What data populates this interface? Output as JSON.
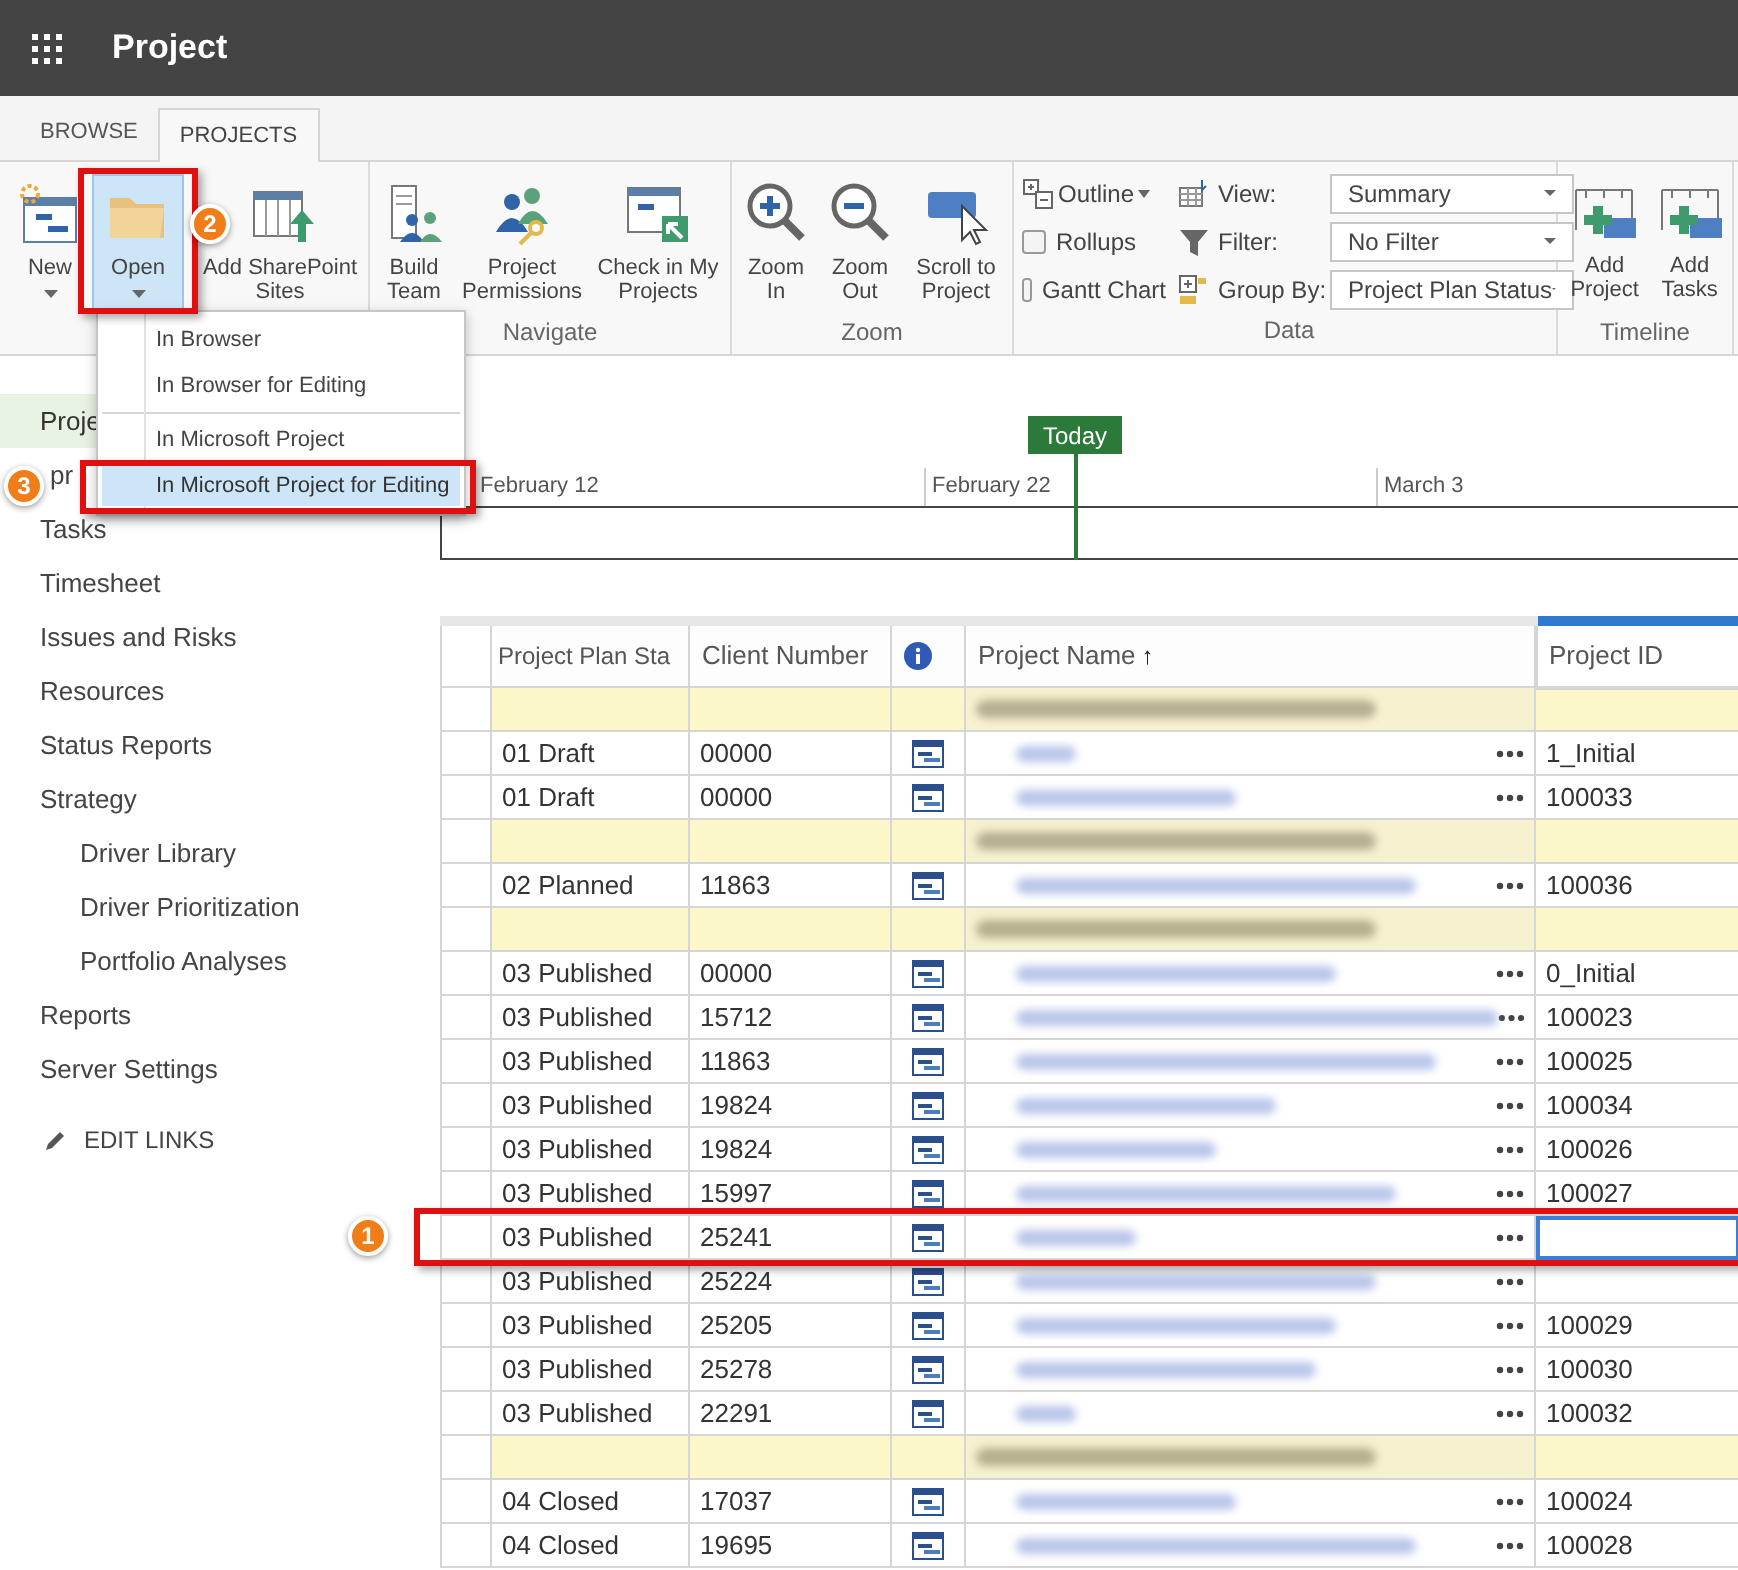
{
  "app": {
    "title": "Project"
  },
  "tabs": [
    {
      "label": "BROWSE",
      "selected": false
    },
    {
      "label": "PROJECTS",
      "selected": true
    }
  ],
  "ribbon": {
    "groups": [
      {
        "buttons": [
          {
            "label": "New",
            "caret": true,
            "selected": false
          },
          {
            "label": "Open",
            "caret": true,
            "selected": true
          },
          {
            "label": "Add SharePoint Sites",
            "caret": false,
            "selected": false
          }
        ]
      },
      {
        "label": "Navigate",
        "buttons": [
          {
            "label": "Build Team",
            "caret": false,
            "selected": false
          },
          {
            "label": "Project Permissions",
            "caret": false,
            "selected": false
          },
          {
            "label": "Check in My Projects",
            "caret": false,
            "selected": false
          }
        ]
      },
      {
        "label": "Zoom",
        "buttons": [
          {
            "label": "Zoom In",
            "caret": false,
            "selected": false
          },
          {
            "label": "Zoom Out",
            "caret": false,
            "selected": false
          },
          {
            "label": "Scroll to Project",
            "caret": false,
            "selected": false
          }
        ]
      }
    ],
    "data_group": {
      "label": "Data",
      "outline": "Outline",
      "checkboxes": [
        {
          "label": "Rollups",
          "checked": false
        },
        {
          "label": "Gantt Chart",
          "checked": false
        }
      ],
      "selects": [
        {
          "label": "View:",
          "value": "Summary"
        },
        {
          "label": "Filter:",
          "value": "No Filter"
        },
        {
          "label": "Group By:",
          "value": "Project Plan Status"
        }
      ]
    },
    "timeline_group": {
      "label": "Timeline",
      "buttons": [
        {
          "label": "Add Project"
        },
        {
          "label": "Add Tasks"
        }
      ]
    }
  },
  "open_menu": {
    "sections": [
      [
        {
          "label": "In Browser",
          "selected": false
        },
        {
          "label": "In Browser for Editing",
          "selected": false
        }
      ],
      [
        {
          "label": "In Microsoft Project",
          "selected": false
        },
        {
          "label": "In Microsoft Project for Editing",
          "selected": true
        }
      ]
    ]
  },
  "sidebar": {
    "items": [
      {
        "label": "Proje",
        "selected": true
      },
      {
        "label": "pr",
        "selected": false
      },
      {
        "label": "Tasks",
        "selected": false
      },
      {
        "label": "Timesheet",
        "selected": false
      },
      {
        "label": "Issues and Risks",
        "selected": false
      },
      {
        "label": "Resources",
        "selected": false
      },
      {
        "label": "Status Reports",
        "selected": false
      },
      {
        "label": "Strategy",
        "selected": false,
        "children": [
          {
            "label": "Driver Library",
            "selected": false
          },
          {
            "label": "Driver Prioritization",
            "selected": false
          },
          {
            "label": "Portfolio Analyses",
            "selected": false
          }
        ]
      },
      {
        "label": "Reports",
        "selected": false
      },
      {
        "label": "Server Settings",
        "selected": false
      }
    ],
    "edit_links": "EDIT LINKS"
  },
  "timeline": {
    "today": "Today",
    "dates": [
      "February 12",
      "February 22",
      "March 3"
    ]
  },
  "grid": {
    "columns": [
      {
        "label": "Project Plan Sta",
        "selected": false
      },
      {
        "label": "Client Number",
        "selected": false
      },
      {
        "kind": "icon"
      },
      {
        "label": "Project Name",
        "sort_indicator": "↑",
        "selected": false
      },
      {
        "label": "Project ID",
        "selected": true
      }
    ],
    "rows": [
      {
        "kind": "group"
      },
      {
        "kind": "project",
        "status": "01 Draft",
        "client": "00000",
        "project_id": "1_Initial",
        "selected": false
      },
      {
        "kind": "project",
        "status": "01 Draft",
        "client": "00000",
        "project_id": "100033",
        "selected": false
      },
      {
        "kind": "group"
      },
      {
        "kind": "project",
        "status": "02 Planned",
        "client": "11863",
        "project_id": "100036",
        "selected": false
      },
      {
        "kind": "group"
      },
      {
        "kind": "project",
        "status": "03 Published",
        "client": "00000",
        "project_id": "0_Initial",
        "selected": false
      },
      {
        "kind": "project",
        "status": "03 Published",
        "client": "15712",
        "project_id": "100023",
        "selected": false
      },
      {
        "kind": "project",
        "status": "03 Published",
        "client": "11863",
        "project_id": "100025",
        "selected": false
      },
      {
        "kind": "project",
        "status": "03 Published",
        "client": "19824",
        "project_id": "100034",
        "selected": false
      },
      {
        "kind": "project",
        "status": "03 Published",
        "client": "19824",
        "project_id": "100026",
        "selected": false
      },
      {
        "kind": "project",
        "status": "03 Published",
        "client": "15997",
        "project_id": "100027",
        "selected": false
      },
      {
        "kind": "project",
        "status": "03 Published",
        "client": "25241",
        "selected": true
      },
      {
        "kind": "project",
        "status": "03 Published",
        "client": "25224",
        "selected": false
      },
      {
        "kind": "project",
        "status": "03 Published",
        "client": "25205",
        "project_id": "100029",
        "selected": false
      },
      {
        "kind": "project",
        "status": "03 Published",
        "client": "25278",
        "project_id": "100030",
        "selected": false
      },
      {
        "kind": "project",
        "status": "03 Published",
        "client": "22291",
        "project_id": "100032",
        "selected": false
      },
      {
        "kind": "group"
      },
      {
        "kind": "project",
        "status": "04 Closed",
        "client": "17037",
        "project_id": "100024",
        "selected": false
      },
      {
        "kind": "project",
        "status": "04 Closed",
        "client": "19695",
        "project_id": "100028",
        "selected": false
      }
    ]
  },
  "callouts": [
    {
      "label": "1"
    },
    {
      "label": "2"
    },
    {
      "label": "3"
    }
  ]
}
